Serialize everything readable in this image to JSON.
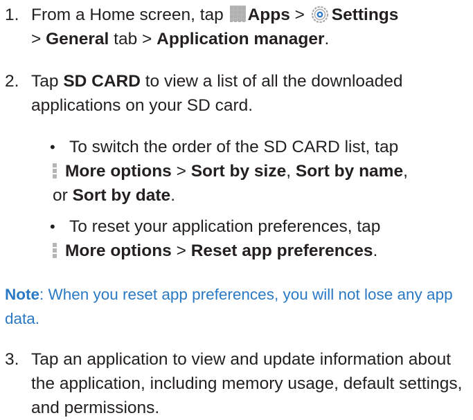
{
  "steps": [
    {
      "number": "1.",
      "lines": {
        "t1": "From a Home screen, tap ",
        "apps": "Apps",
        "sep1": " > ",
        "settings": "Settings",
        "sep2": "> ",
        "general": "General",
        "t2": " tab > ",
        "app_manager": "Application manager",
        "end": "."
      }
    },
    {
      "number": "2.",
      "lines": {
        "t1": "Tap ",
        "sd": "SD CARD",
        "t2": " to view a list of all the downloaded applications on your SD card."
      }
    },
    {
      "number": "3.",
      "text": "Tap an application to view and update information about the application, including memory usage, default settings, and permissions."
    }
  ],
  "bullets": [
    {
      "t1": "To switch the order of the SD CARD list, tap",
      "more": "More options",
      "sep1": " > ",
      "size": "Sort by size",
      "comma1": ", ",
      "name": "Sort by name",
      "comma2": ",",
      "or": "or ",
      "date": "Sort by date",
      "end": "."
    },
    {
      "t1": "To reset your application preferences, tap",
      "more": "More options",
      "sep1": " > ",
      "reset": "Reset app preferences",
      "end": "."
    }
  ],
  "note": {
    "label": "Note",
    "text": ": When you reset app preferences, you will not lose any app data."
  },
  "colors": {
    "text": "#231f20",
    "note": "#2a79c4",
    "icon_gray": "#b6b6b6"
  },
  "icons": {
    "apps": "apps-grid-icon",
    "settings": "settings-gear-icon",
    "more": "more-options-icon"
  }
}
